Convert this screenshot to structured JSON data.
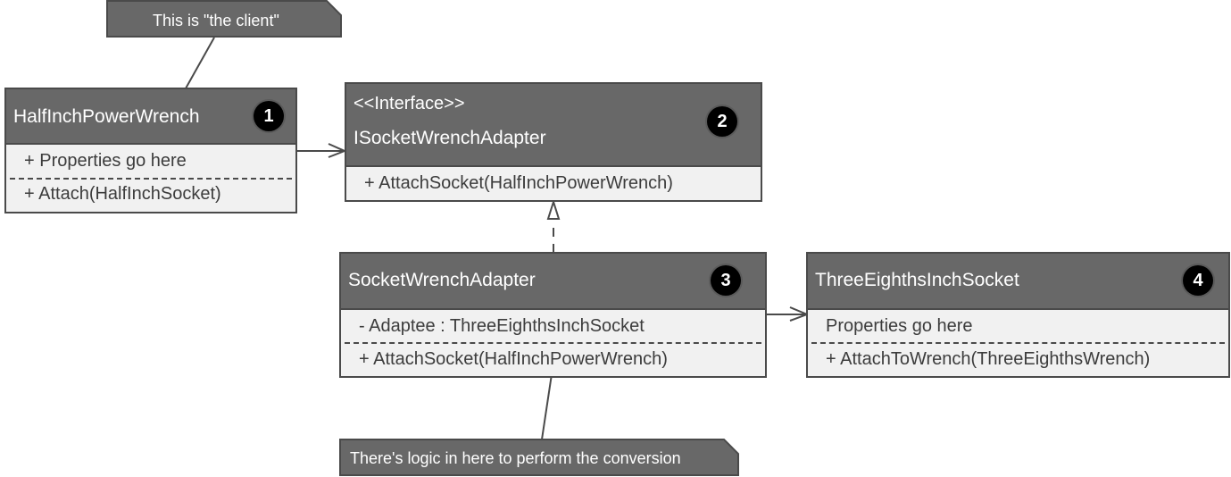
{
  "notes": {
    "client": "This is \"the client\"",
    "conversion": "There's logic in here to perform the conversion"
  },
  "classes": {
    "half_inch_power_wrench": {
      "name": "HalfInchPowerWrench",
      "badge": "1",
      "attributes": [
        "+ Properties go here"
      ],
      "operations": [
        "+ Attach(HalfInchSocket)"
      ]
    },
    "isocket_wrench_adapter": {
      "stereotype": "<<Interface>>",
      "name": "ISocketWrenchAdapter",
      "badge": "2",
      "operations": [
        "+ AttachSocket(HalfInchPowerWrench)"
      ]
    },
    "socket_wrench_adapter": {
      "name": "SocketWrenchAdapter",
      "badge": "3",
      "attributes": [
        "- Adaptee : ThreeEighthsInchSocket"
      ],
      "operations": [
        "+ AttachSocket(HalfInchPowerWrench)"
      ]
    },
    "three_eighths_inch_socket": {
      "name": "ThreeEighthsInchSocket",
      "badge": "4",
      "attributes": [
        "Properties go here"
      ],
      "operations": [
        "+ AttachToWrench(ThreeEighthsWrench)"
      ]
    }
  },
  "relationships": [
    {
      "from": "HalfInchPowerWrench",
      "to": "ISocketWrenchAdapter",
      "type": "association"
    },
    {
      "from": "SocketWrenchAdapter",
      "to": "ISocketWrenchAdapter",
      "type": "realization"
    },
    {
      "from": "SocketWrenchAdapter",
      "to": "ThreeEighthsInchSocket",
      "type": "association"
    }
  ],
  "colors": {
    "header_fill": "#686868",
    "body_fill": "#f1f1f1",
    "border": "#4a4a4a",
    "badge_fill": "#000000"
  }
}
